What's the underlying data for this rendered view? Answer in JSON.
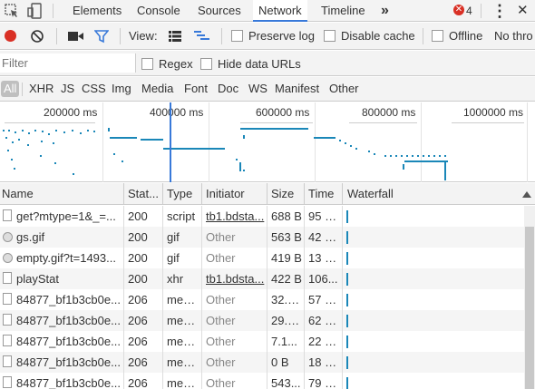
{
  "tabs": {
    "items": [
      {
        "label": "Elements"
      },
      {
        "label": "Console"
      },
      {
        "label": "Sources"
      },
      {
        "label": "Network"
      },
      {
        "label": "Timeline"
      }
    ],
    "more": "»",
    "error_count": "4",
    "menu": "⋮",
    "close": "✕"
  },
  "toolbar": {
    "view_label": "View:",
    "preserve_log": "Preserve log",
    "disable_cache": "Disable cache",
    "offline": "Offline",
    "throttle": "No thro"
  },
  "filter": {
    "placeholder": "Filter",
    "regex": "Regex",
    "hide_data_urls": "Hide data URLs"
  },
  "types": [
    "All",
    "XHR",
    "JS",
    "CSS",
    "Img",
    "Media",
    "Font",
    "Doc",
    "WS",
    "Manifest",
    "Other"
  ],
  "overview": {
    "ticks": [
      "200000 ms",
      "400000 ms",
      "600000 ms",
      "800000 ms",
      "1000000 ms"
    ]
  },
  "columns": [
    "Name",
    "Stat...",
    "Type",
    "Initiator",
    "Size",
    "Time",
    "Waterfall"
  ],
  "rows": [
    {
      "name": "get?mtype=1&_=...",
      "status": "200",
      "type": "script",
      "initiator": "tb1.bdsta...",
      "initiator_link": true,
      "size": "688 B",
      "time": "95 m..."
    },
    {
      "name": "gs.gif",
      "status": "200",
      "type": "gif",
      "initiator": "Other",
      "initiator_link": false,
      "size": "563 B",
      "time": "42 m..."
    },
    {
      "name": "empty.gif?t=1493...",
      "status": "200",
      "type": "gif",
      "initiator": "Other",
      "initiator_link": false,
      "size": "419 B",
      "time": "13 m..."
    },
    {
      "name": "playStat",
      "status": "200",
      "type": "xhr",
      "initiator": "tb1.bdsta...",
      "initiator_link": true,
      "size": "422 B",
      "time": "106..."
    },
    {
      "name": "84877_bf1b3cb0e...",
      "status": "206",
      "type": "med...",
      "initiator": "Other",
      "initiator_link": false,
      "size": "32.9...",
      "time": "57 m..."
    },
    {
      "name": "84877_bf1b3cb0e...",
      "status": "206",
      "type": "med...",
      "initiator": "Other",
      "initiator_link": false,
      "size": "29.0...",
      "time": "62 m..."
    },
    {
      "name": "84877_bf1b3cb0e...",
      "status": "206",
      "type": "med...",
      "initiator": "Other",
      "initiator_link": false,
      "size": "7.1...",
      "time": "22 m..."
    },
    {
      "name": "84877_bf1b3cb0e...",
      "status": "206",
      "type": "med...",
      "initiator": "Other",
      "initiator_link": false,
      "size": "0 B",
      "time": "18 m..."
    },
    {
      "name": "84877_bf1b3cb0e...",
      "status": "206",
      "type": "med...",
      "initiator": "Other",
      "initiator_link": false,
      "size": "543...",
      "time": "79 m..."
    }
  ],
  "colors": {
    "accent": "#3879d9",
    "record": "#d93025",
    "waterfall": "#1a87b8",
    "error": "#d93025"
  }
}
